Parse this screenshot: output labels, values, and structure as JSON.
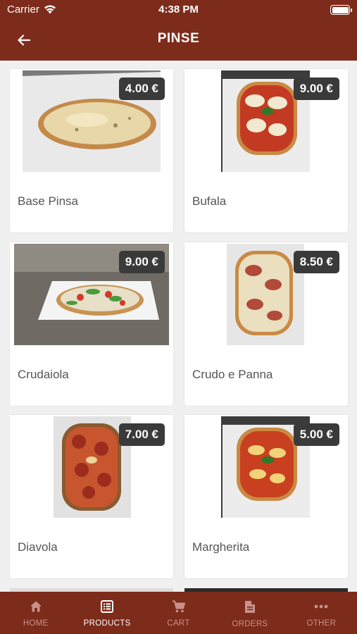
{
  "status": {
    "carrier": "Carrier",
    "time": "4:38 PM"
  },
  "header": {
    "title": "PINSE"
  },
  "products": [
    {
      "name": "Base Pinsa",
      "price": "4.00 €"
    },
    {
      "name": "Bufala",
      "price": "9.00 €"
    },
    {
      "name": "Crudaiola",
      "price": "9.00 €"
    },
    {
      "name": "Crudo e Panna",
      "price": "8.50 €"
    },
    {
      "name": "Diavola",
      "price": "7.00 €"
    },
    {
      "name": "Margherita",
      "price": "5.00 €"
    }
  ],
  "tabs": [
    {
      "label": "HOME",
      "icon": "home-icon"
    },
    {
      "label": "PRODUCTS",
      "icon": "menu-list-icon",
      "active": true
    },
    {
      "label": "CART",
      "icon": "cart-icon"
    },
    {
      "label": "ORDERS",
      "icon": "document-icon"
    },
    {
      "label": "OTHER",
      "icon": "more-dots-icon"
    }
  ],
  "colors": {
    "brand": "#7d2b1b",
    "price_badge": "#3a3a3a",
    "tab_inactive": "#c8928a"
  }
}
